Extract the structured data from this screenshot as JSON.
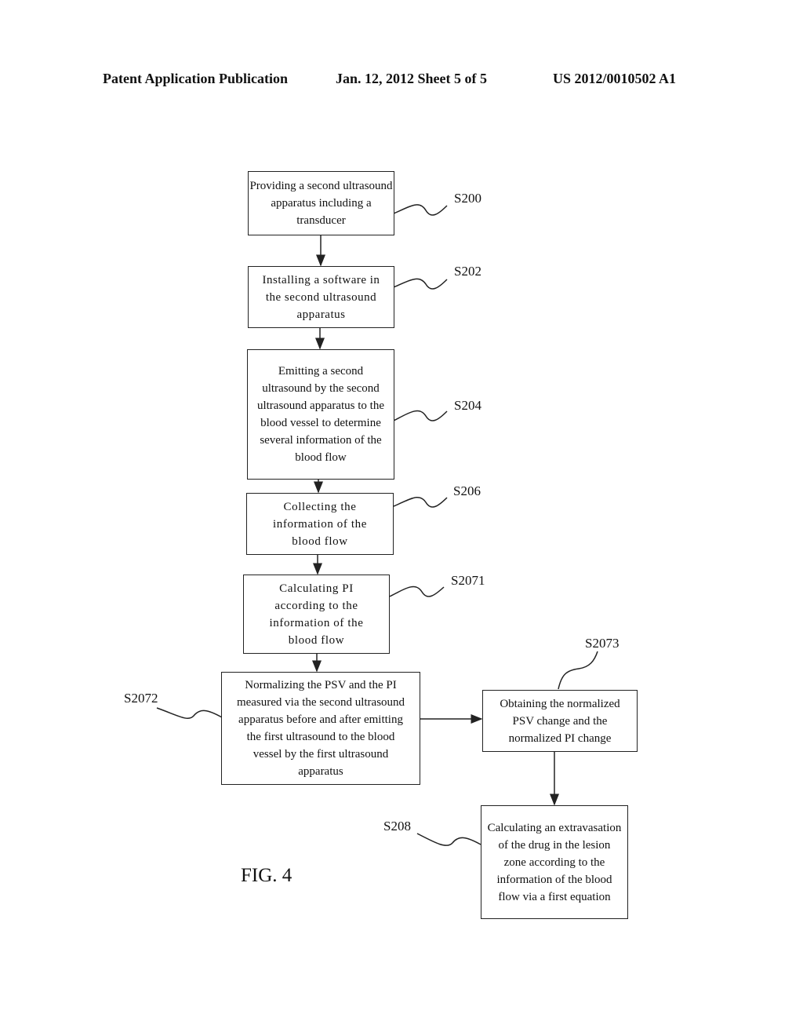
{
  "header": {
    "left": "Patent Application Publication",
    "center": "Jan. 12, 2012  Sheet 5 of 5",
    "right": "US 2012/0010502 A1"
  },
  "figure_label": "FIG. 4",
  "steps": [
    {
      "id": "S200",
      "text": "Providing a second ultrasound apparatus including a transducer"
    },
    {
      "id": "S202",
      "text": "Installing a software in the second ultrasound apparatus"
    },
    {
      "id": "S204",
      "text": "Emitting a second ultrasound by the second ultrasound apparatus to the blood vessel to determine several information of the blood flow"
    },
    {
      "id": "S206",
      "text": "Collecting the information of the blood flow"
    },
    {
      "id": "S2071",
      "text": "Calculating PI according to the information of the blood flow"
    },
    {
      "id": "S2072",
      "text": "Normalizing the PSV and the PI measured via the second ultrasound apparatus before and after emitting the first ultrasound to the blood vessel by the first ultrasound apparatus"
    },
    {
      "id": "S2073",
      "text": "Obtaining the normalized PSV change and the normalized PI change"
    },
    {
      "id": "S208",
      "text": "Calculating an extravasation of the drug in the lesion zone according to the information of the blood flow via a first equation"
    }
  ]
}
